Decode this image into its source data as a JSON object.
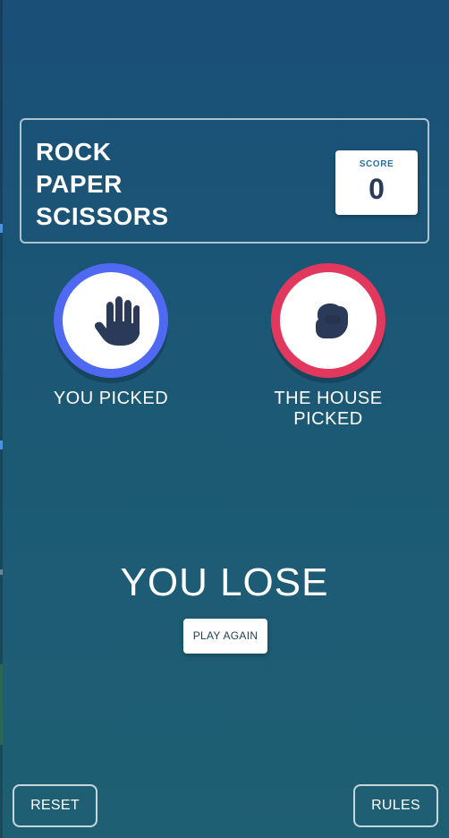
{
  "header": {
    "title_lines": [
      "ROCK",
      "PAPER",
      "SCISSORS"
    ],
    "score_label": "SCORE",
    "score_value": "0"
  },
  "picks": {
    "you": {
      "label": "YOU PICKED",
      "choice_icon": "paper-hand-icon",
      "ring_color": "#4F69F2"
    },
    "house": {
      "label": "THE HOUSE PICKED",
      "choice_icon": "rock-fist-icon",
      "ring_color": "#E2385D"
    }
  },
  "result": {
    "text": "YOU LOSE",
    "play_again_label": "PLAY AGAIN"
  },
  "footer": {
    "reset_label": "RESET",
    "rules_label": "RULES"
  }
}
